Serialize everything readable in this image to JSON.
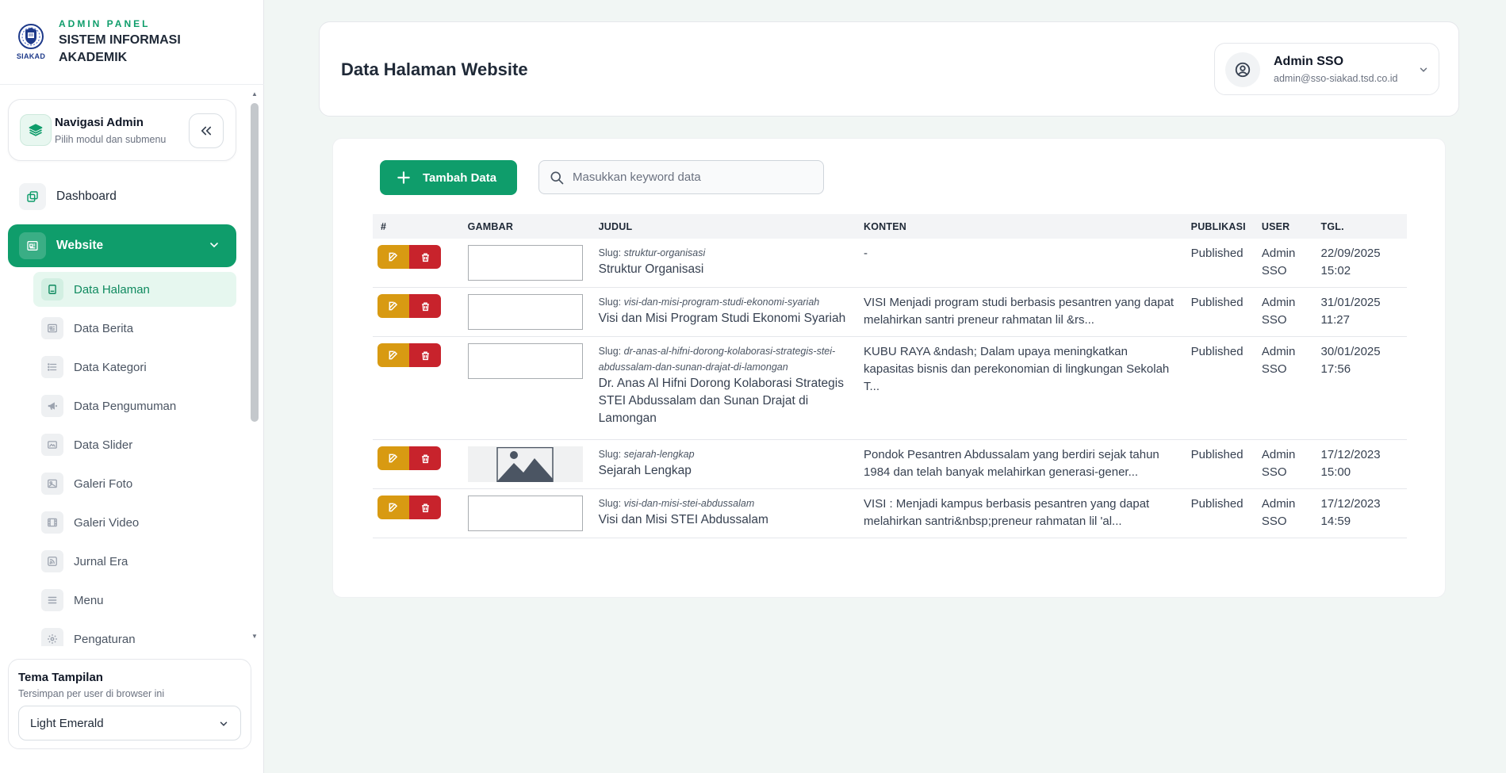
{
  "brand": {
    "logo_text": "SIAKAD",
    "kicker": "ADMIN PANEL",
    "title": "SISTEM INFORMASI AKADEMIK"
  },
  "nav_card": {
    "title": "Navigasi Admin",
    "subtitle": "Pilih modul dan submenu"
  },
  "menu": {
    "dashboard": "Dashboard",
    "website": "Website",
    "sub_items": [
      {
        "label": "Data Halaman",
        "icon": "page-icon"
      },
      {
        "label": "Data Berita",
        "icon": "news-icon"
      },
      {
        "label": "Data Kategori",
        "icon": "list-icon"
      },
      {
        "label": "Data Pengumuman",
        "icon": "megaphone-icon"
      },
      {
        "label": "Data Slider",
        "icon": "slider-icon"
      },
      {
        "label": "Galeri Foto",
        "icon": "photo-icon"
      },
      {
        "label": "Galeri Video",
        "icon": "film-icon"
      },
      {
        "label": "Jurnal Era",
        "icon": "rss-icon"
      },
      {
        "label": "Menu",
        "icon": "menu-icon"
      },
      {
        "label": "Pengaturan",
        "icon": "gear-icon"
      }
    ]
  },
  "theme": {
    "title": "Tema Tampilan",
    "subtitle": "Tersimpan per user di browser ini",
    "selected": "Light Emerald"
  },
  "header": {
    "page_title": "Data Halaman Website",
    "user_name": "Admin SSO",
    "user_email": "admin@sso-siakad.tsd.co.id"
  },
  "toolbar": {
    "add_label": "Tambah Data",
    "search_placeholder": "Masukkan keyword data"
  },
  "table": {
    "headers": {
      "num": "#",
      "gambar": "GAMBAR",
      "judul": "JUDUL",
      "konten": "KONTEN",
      "publikasi": "PUBLIKASI",
      "user": "USER",
      "tgl": "TGL."
    },
    "slug_prefix": "Slug:",
    "rows": [
      {
        "slug": "struktur-organisasi",
        "judul": "Struktur Organisasi",
        "konten": "-",
        "publikasi": "Published",
        "user": "Admin SSO",
        "tgl": "22/09/2025 15:02",
        "image": "broken"
      },
      {
        "slug": "visi-dan-misi-program-studi-ekonomi-syariah",
        "judul": "Visi dan Misi Program Studi Ekonomi Syariah",
        "konten": "VISI Menjadi program studi berbasis pesantren yang dapat melahirkan santri preneur rahmatan lil &rs...",
        "publikasi": "Published",
        "user": "Admin SSO",
        "tgl": "31/01/2025 11:27",
        "image": "broken"
      },
      {
        "slug": "dr-anas-al-hifni-dorong-kolaborasi-strategis-stei-abdussalam-dan-sunan-drajat-di-lamongan",
        "judul": "Dr. Anas Al Hifni Dorong Kolaborasi Strategis STEI Abdussalam dan Sunan Drajat di Lamongan",
        "konten": "KUBU RAYA &ndash; Dalam upaya meningkatkan kapasitas bisnis dan perekonomian di lingkungan Sekolah T...",
        "publikasi": "Published",
        "user": "Admin SSO",
        "tgl": "30/01/2025 17:56",
        "image": "broken"
      },
      {
        "slug": "sejarah-lengkap",
        "judul": "Sejarah Lengkap",
        "konten": "Pondok Pesantren Abdussalam yang berdiri sejak tahun 1984 dan telah banyak melahirkan generasi-gener...",
        "publikasi": "Published",
        "user": "Admin SSO",
        "tgl": "17/12/2023 15:00",
        "image": "placeholder"
      },
      {
        "slug": "visi-dan-misi-stei-abdussalam",
        "judul": "Visi dan Misi STEI Abdussalam",
        "konten": "VISI : Menjadi kampus berbasis pesantren yang dapat melahirkan santri&nbsp;preneur rahmatan lil 'al...",
        "publikasi": "Published",
        "user": "Admin SSO",
        "tgl": "17/12/2023 14:59",
        "image": "broken"
      }
    ]
  },
  "colors": {
    "accent": "#0f9d6b",
    "edit": "#d89a12",
    "delete": "#c8232c"
  }
}
